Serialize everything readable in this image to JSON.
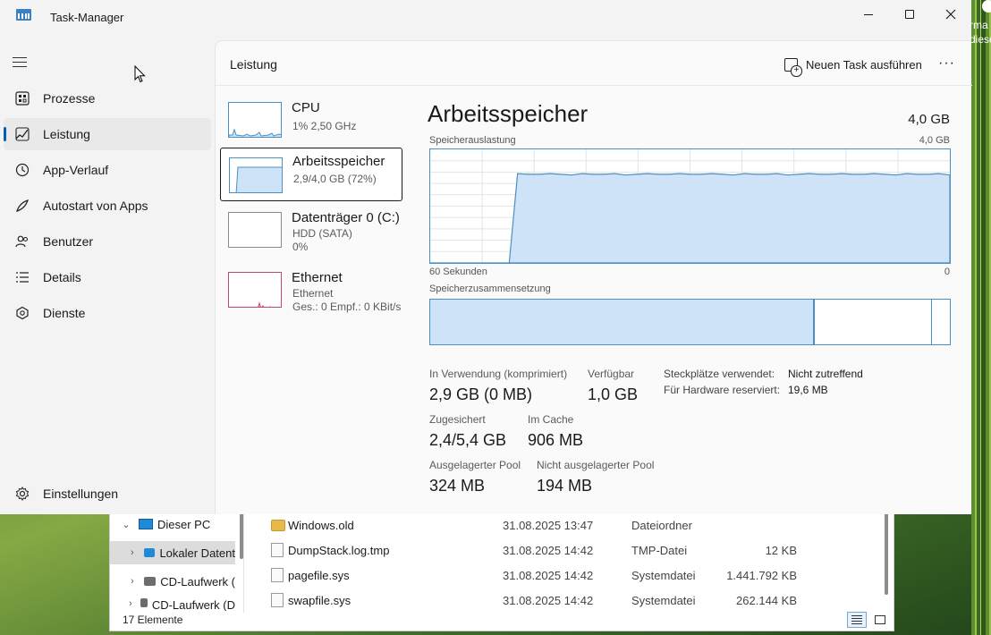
{
  "desktop": {
    "text_line1": "rma",
    "text_line2": "diese"
  },
  "titlebar": {
    "title": "Task-Manager"
  },
  "sidebar": {
    "items": [
      {
        "label": "Prozesse",
        "icon": "processes-icon"
      },
      {
        "label": "Leistung",
        "icon": "performance-icon",
        "active": true
      },
      {
        "label": "App-Verlauf",
        "icon": "history-icon"
      },
      {
        "label": "Autostart von Apps",
        "icon": "startup-icon"
      },
      {
        "label": "Benutzer",
        "icon": "users-icon"
      },
      {
        "label": "Details",
        "icon": "details-icon"
      },
      {
        "label": "Dienste",
        "icon": "services-icon"
      }
    ],
    "settings_label": "Einstellungen"
  },
  "main": {
    "page_title": "Leistung",
    "new_task_label": "Neuen Task ausführen",
    "more_label": "···"
  },
  "resources": [
    {
      "name": "CPU",
      "sub1": "1% 2,50 GHz",
      "sub2": ""
    },
    {
      "name": "Arbeitsspeicher",
      "sub1": "2,9/4,0 GB (72%)",
      "sub2": "",
      "selected": true
    },
    {
      "name": "Datenträger 0 (C:)",
      "sub1": "HDD (SATA)",
      "sub2": "0%"
    },
    {
      "name": "Ethernet",
      "sub1": "Ethernet",
      "sub2": "Ges.: 0 Empf.: 0 KBit/s"
    }
  ],
  "detail": {
    "title": "Arbeitsspeicher",
    "total": "4,0 GB",
    "usage_caption": "Speicherauslastung",
    "usage_max": "4,0 GB",
    "time_left": "60 Sekunden",
    "time_right": "0",
    "composition_caption": "Speicherzusammensetzung",
    "usage_fraction": 0.78,
    "composition": {
      "in_use_fraction": 0.74,
      "standby_end_fraction": 0.963
    },
    "stats": {
      "in_use_label": "In Verwendung (komprimiert)",
      "in_use_value": "2,9 GB (0 MB)",
      "available_label": "Verfügbar",
      "available_value": "1,0 GB",
      "committed_label": "Zugesichert",
      "committed_value": "2,4/5,4 GB",
      "cached_label": "Im Cache",
      "cached_value": "906 MB",
      "paged_label": "Ausgelagerter Pool",
      "paged_value": "324 MB",
      "nonpaged_label": "Nicht ausgelagerter Pool",
      "nonpaged_value": "194 MB"
    },
    "slots_label": "Steckplätze verwendet:",
    "slots_value": "Nicht zutreffend",
    "hw_reserved_label": "Für Hardware reserviert:",
    "hw_reserved_value": "19,6 MB"
  },
  "explorer": {
    "tree": [
      {
        "label": "Dieser PC",
        "chevron": "⌄"
      },
      {
        "label": "Lokaler Datent",
        "chevron": "›"
      },
      {
        "label": "CD-Laufwerk (",
        "chevron": "›"
      },
      {
        "label": "CD-Laufwerk (D",
        "chevron": "›"
      }
    ],
    "files": [
      {
        "name": "Windows.old",
        "date": "31.08.2025 13:47",
        "type": "Dateiordner",
        "size": ""
      },
      {
        "name": "DumpStack.log.tmp",
        "date": "31.08.2025 14:42",
        "type": "TMP-Datei",
        "size": "12 KB"
      },
      {
        "name": "pagefile.sys",
        "date": "31.08.2025 14:42",
        "type": "Systemdatei",
        "size": "1.441.792 KB"
      },
      {
        "name": "swapfile.sys",
        "date": "31.08.2025 14:42",
        "type": "Systemdatei",
        "size": "262.144 KB"
      }
    ],
    "status": "17 Elemente"
  },
  "colors": {
    "accent": "#005fb8",
    "memory_line": "#4a90c2",
    "memory_fill": "#cfe3f8",
    "ethernet": "#c2457c"
  }
}
